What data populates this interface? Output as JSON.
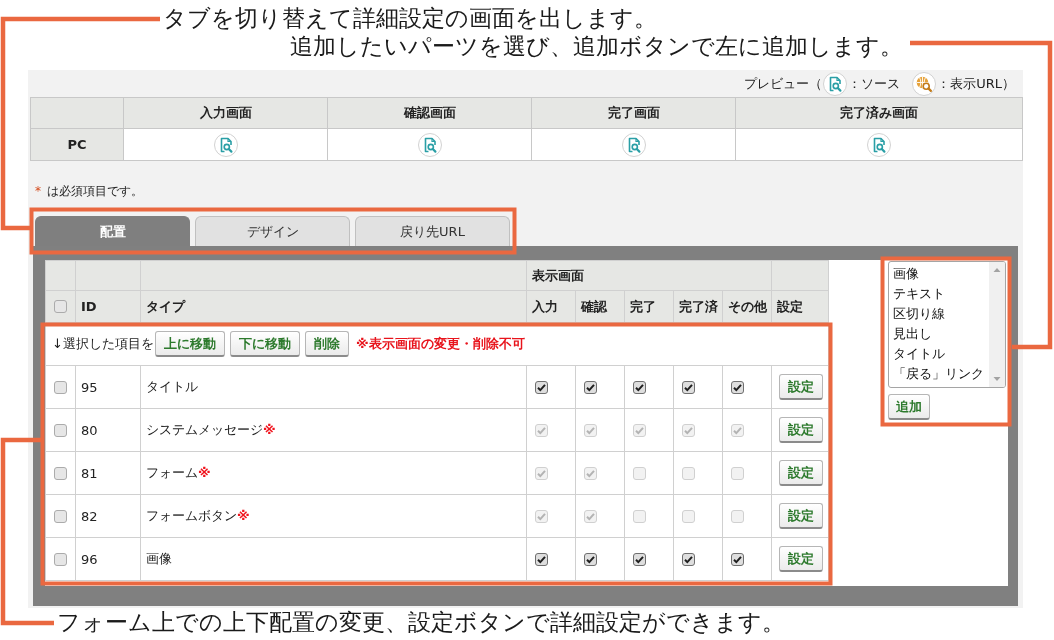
{
  "top_notes": [
    "タブを切り替えて詳細設定の画面を出します。",
    "追加したいパーツを選び、追加ボタンで左に追加します。"
  ],
  "preview_legend": {
    "label": "プレビュー（",
    "items": [
      {
        "kind": "source",
        "text": "：ソース"
      },
      {
        "kind": "url",
        "text": "：表示URL）"
      }
    ]
  },
  "preview_table": {
    "columns": [
      "入力画面",
      "確認画面",
      "完了画面",
      "完了済み画面"
    ],
    "rows": [
      {
        "label": "PC"
      }
    ]
  },
  "required_note": {
    "mark": "*",
    "text": "は必須項目です。"
  },
  "tabs": [
    {
      "label": "配置",
      "selected": true
    },
    {
      "label": "デザイン",
      "selected": false
    },
    {
      "label": "戻り先URL",
      "selected": false
    }
  ],
  "parts_table": {
    "select_all": {
      "checked": false
    },
    "group_heading": "表示画面",
    "columns": [
      "ID",
      "タイプ",
      "入力",
      "確認",
      "完了",
      "完了済",
      "その他",
      "設定"
    ],
    "toolbar": {
      "label": "↓選択した項目を",
      "buttons": [
        "上に移動",
        "下に移動",
        "削除"
      ],
      "notice": "※表示画面の変更・削除不可"
    },
    "rows": [
      {
        "selected": false,
        "id": "95",
        "type": "タイトル",
        "screens": [
          {
            "checked": true,
            "disabled": false
          },
          {
            "checked": true,
            "disabled": false
          },
          {
            "checked": true,
            "disabled": false
          },
          {
            "checked": true,
            "disabled": false
          },
          {
            "checked": true,
            "disabled": false
          }
        ],
        "button": "設定"
      },
      {
        "selected": false,
        "id": "80",
        "type": "システムメッセージ**※**",
        "screens": [
          {
            "checked": true,
            "disabled": true
          },
          {
            "checked": true,
            "disabled": true
          },
          {
            "checked": true,
            "disabled": true
          },
          {
            "checked": true,
            "disabled": true
          },
          {
            "checked": true,
            "disabled": true
          }
        ],
        "button": "設定"
      },
      {
        "selected": false,
        "id": "81",
        "type": "フォーム**※**",
        "screens": [
          {
            "checked": true,
            "disabled": true
          },
          {
            "checked": true,
            "disabled": true
          },
          {
            "checked": false,
            "disabled": true
          },
          {
            "checked": false,
            "disabled": true
          },
          {
            "checked": false,
            "disabled": true
          }
        ],
        "button": "設定"
      },
      {
        "selected": false,
        "id": "82",
        "type": "フォームボタン**※**",
        "screens": [
          {
            "checked": true,
            "disabled": true
          },
          {
            "checked": true,
            "disabled": true
          },
          {
            "checked": false,
            "disabled": true
          },
          {
            "checked": false,
            "disabled": true
          },
          {
            "checked": false,
            "disabled": true
          }
        ],
        "button": "設定"
      },
      {
        "selected": false,
        "id": "96",
        "type": "画像",
        "screens": [
          {
            "checked": true,
            "disabled": false
          },
          {
            "checked": true,
            "disabled": false
          },
          {
            "checked": true,
            "disabled": false
          },
          {
            "checked": true,
            "disabled": false
          },
          {
            "checked": true,
            "disabled": false
          }
        ],
        "button": "設定"
      }
    ]
  },
  "parts_list": {
    "items": [
      {
        "label": "画像",
        "selected": false
      },
      {
        "label": "テキスト",
        "selected": false
      },
      {
        "label": "区切り線",
        "selected": false
      },
      {
        "label": "見出し",
        "selected": false
      },
      {
        "label": "タイトル",
        "selected": false
      },
      {
        "label": "「戻る」リンク",
        "selected": false
      }
    ],
    "add_button": "追加"
  },
  "bottom_note": "フォーム上での上下配置の変更、設定ボタンで詳細設定ができます。"
}
